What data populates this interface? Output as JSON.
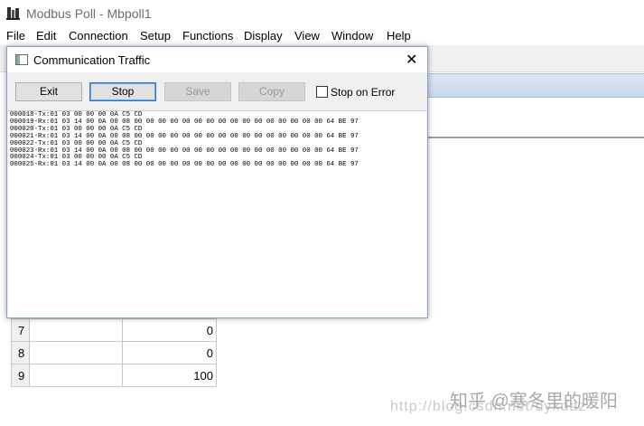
{
  "app": {
    "title": "Modbus Poll - Mbpoll1",
    "icon": "modbus-poll-app-icon"
  },
  "menu": [
    "File",
    "Edit",
    "Connection",
    "Setup",
    "Functions",
    "Display",
    "View",
    "Window",
    "Help"
  ],
  "dialog": {
    "title": "Communication Traffic",
    "close_glyph": "✕",
    "buttons": {
      "exit": "Exit",
      "stop": "Stop",
      "save": "Save",
      "copy": "Copy"
    },
    "stop_on_error": {
      "label": "Stop on Error",
      "checked": false
    },
    "traffic_lines": [
      "000018-Tx:01 03 00 00 00 0A C5 CD",
      "000019-Rx:01 03 14 00 0A 00 08 00 00 00 00 00 00 00 00 00 00 00 00 00 00 00 00 64 BE 97",
      "000020-Tx:01 03 00 00 00 0A C5 CD",
      "000021-Rx:01 03 14 00 0A 00 08 00 00 00 00 00 00 00 00 00 00 00 00 00 00 00 00 64 BE 97",
      "000022-Tx:01 03 00 00 00 0A C5 CD",
      "000023-Rx:01 03 14 00 0A 00 08 00 00 00 00 00 00 00 00 00 00 00 00 00 00 00 00 64 BE 97",
      "000024-Tx:01 03 00 00 00 0A C5 CD",
      "000025-Rx:01 03 14 00 0A 00 08 00 00 00 00 00 00 00 00 00 00 00 00 00 00 00 00 64 BE 97"
    ]
  },
  "table": {
    "rows": [
      {
        "no": "7",
        "name": "",
        "value": "0"
      },
      {
        "no": "8",
        "name": "",
        "value": "0"
      },
      {
        "no": "9",
        "name": "",
        "value": "100"
      }
    ]
  },
  "watermark": {
    "text": "知乎 @寒冬里的暖阳",
    "url": "http://blog.csdn.net/dyxdaz"
  }
}
